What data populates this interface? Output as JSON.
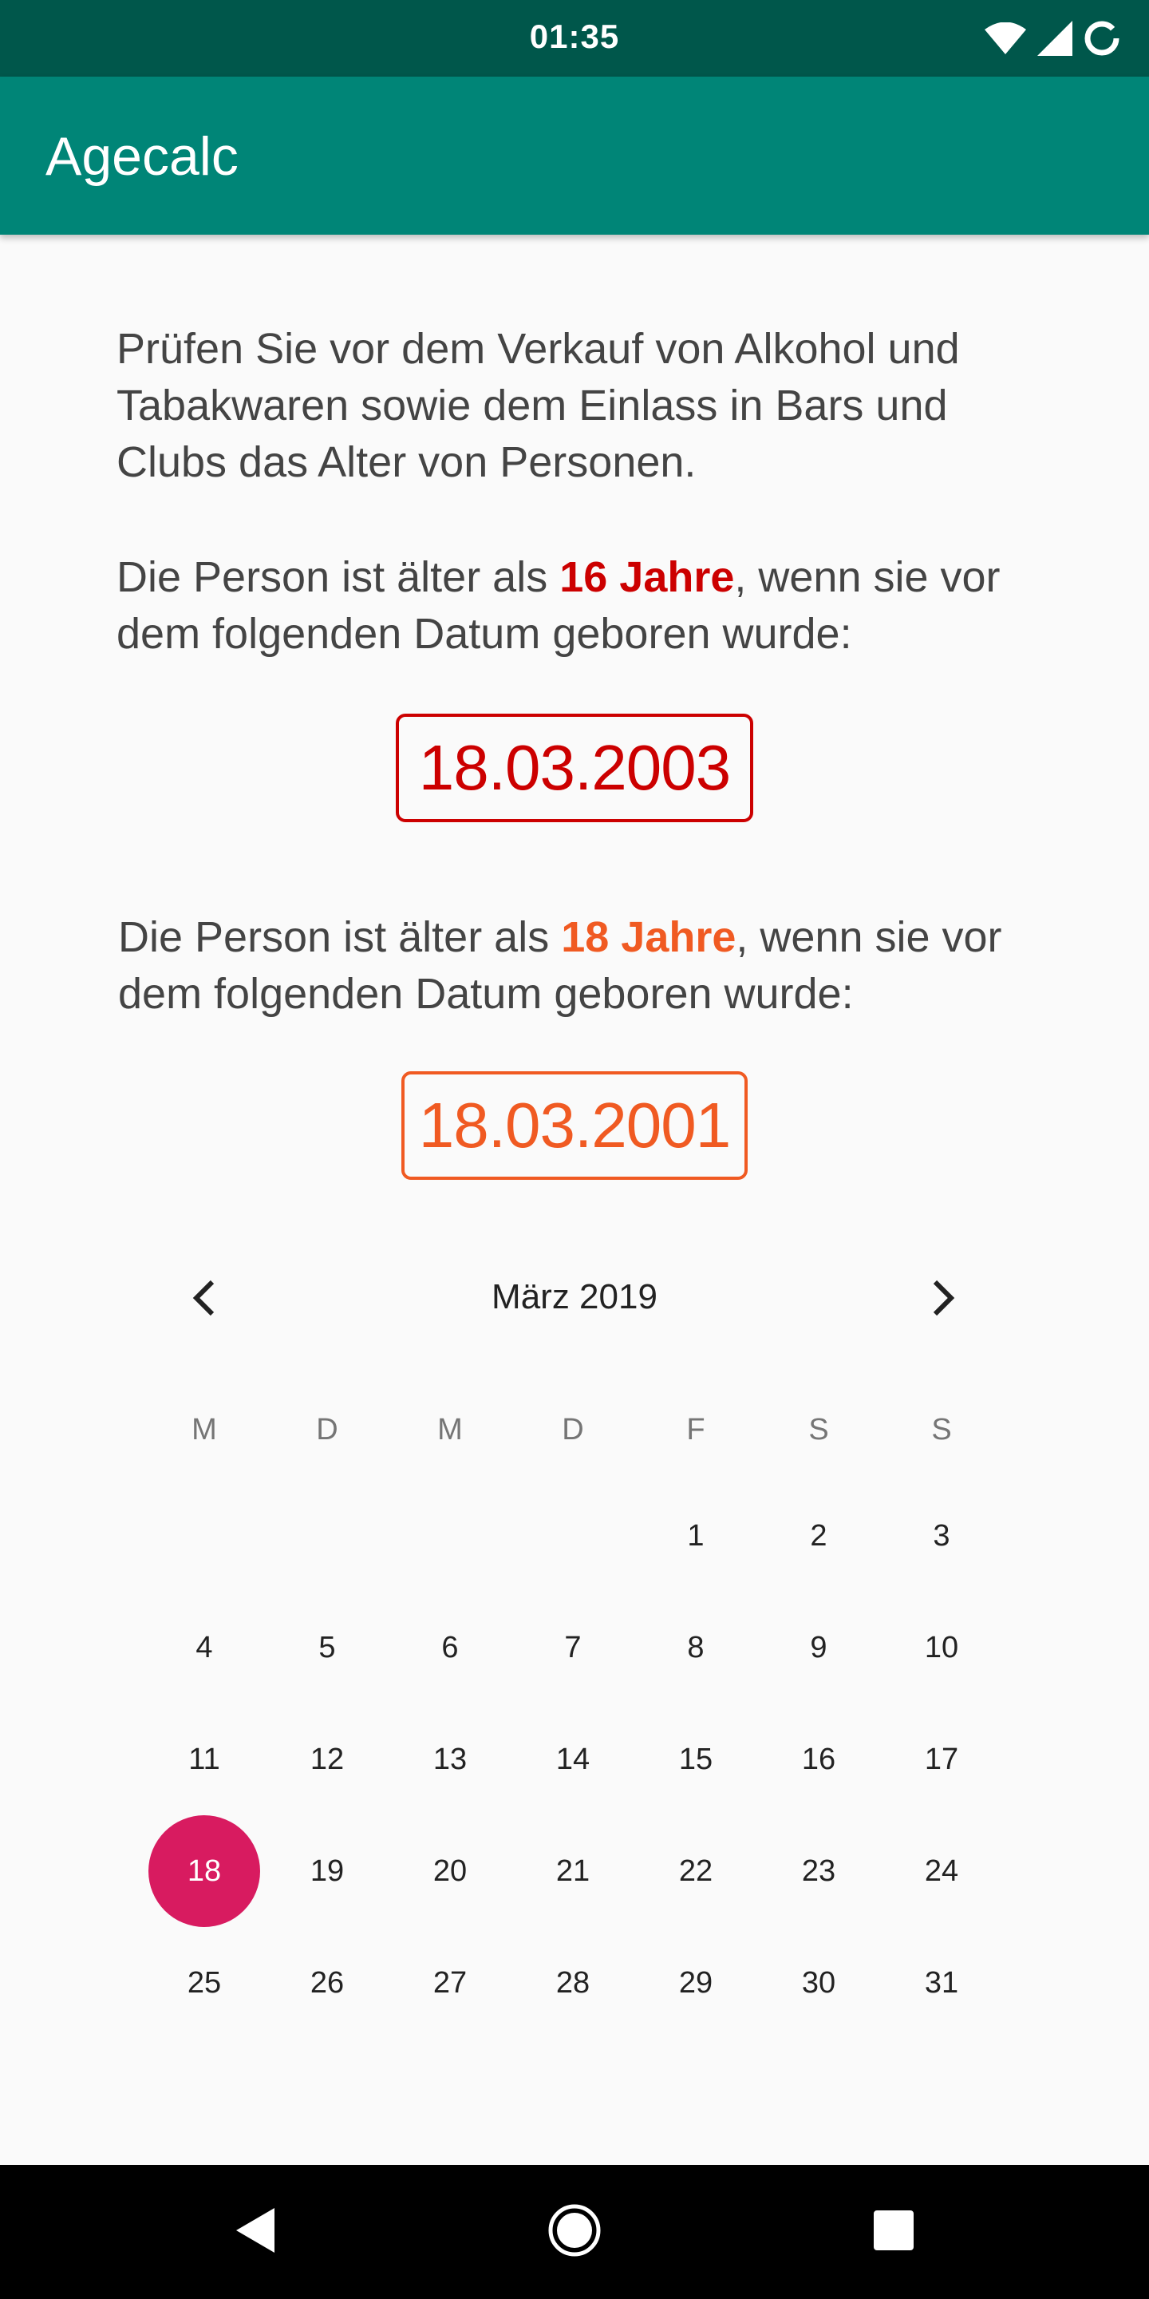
{
  "status_bar": {
    "time": "01:35",
    "icons": [
      "wifi-icon",
      "signal-icon",
      "battery-icon"
    ]
  },
  "app_bar": {
    "title": "Agecalc"
  },
  "intro": {
    "text": "Prüfen Sie vor dem Verkauf von Alkohol und Tabakwaren sowie dem Einlass in Bars und Clubs das Alter von Personen."
  },
  "age16": {
    "prefix": "Die Person ist älter als ",
    "highlight": "16 Jahre",
    "suffix": ", wenn sie vor dem folgenden Datum geboren wurde:",
    "date": "18.03.2003",
    "color": "#cc0000"
  },
  "age18": {
    "prefix": "Die Person ist älter als ",
    "highlight": "18 Jahre",
    "suffix": ", wenn sie vor dem folgenden Datum geboren wurde:",
    "date": "18.03.2001",
    "color": "#f05a22"
  },
  "calendar": {
    "month_label": "März 2019",
    "prev_icon": "chevron-left-icon",
    "next_icon": "chevron-right-icon",
    "weekdays": [
      "M",
      "D",
      "M",
      "D",
      "F",
      "S",
      "S"
    ],
    "first_weekday_index": 4,
    "days_in_month": 31,
    "selected_day": "18",
    "selected_color": "#d81b60"
  },
  "nav_bar": {
    "icons": [
      "back-icon",
      "home-icon",
      "recents-icon"
    ]
  },
  "colors": {
    "status_bar": "#00574b",
    "app_bar": "#008577",
    "background": "#fafafa"
  }
}
